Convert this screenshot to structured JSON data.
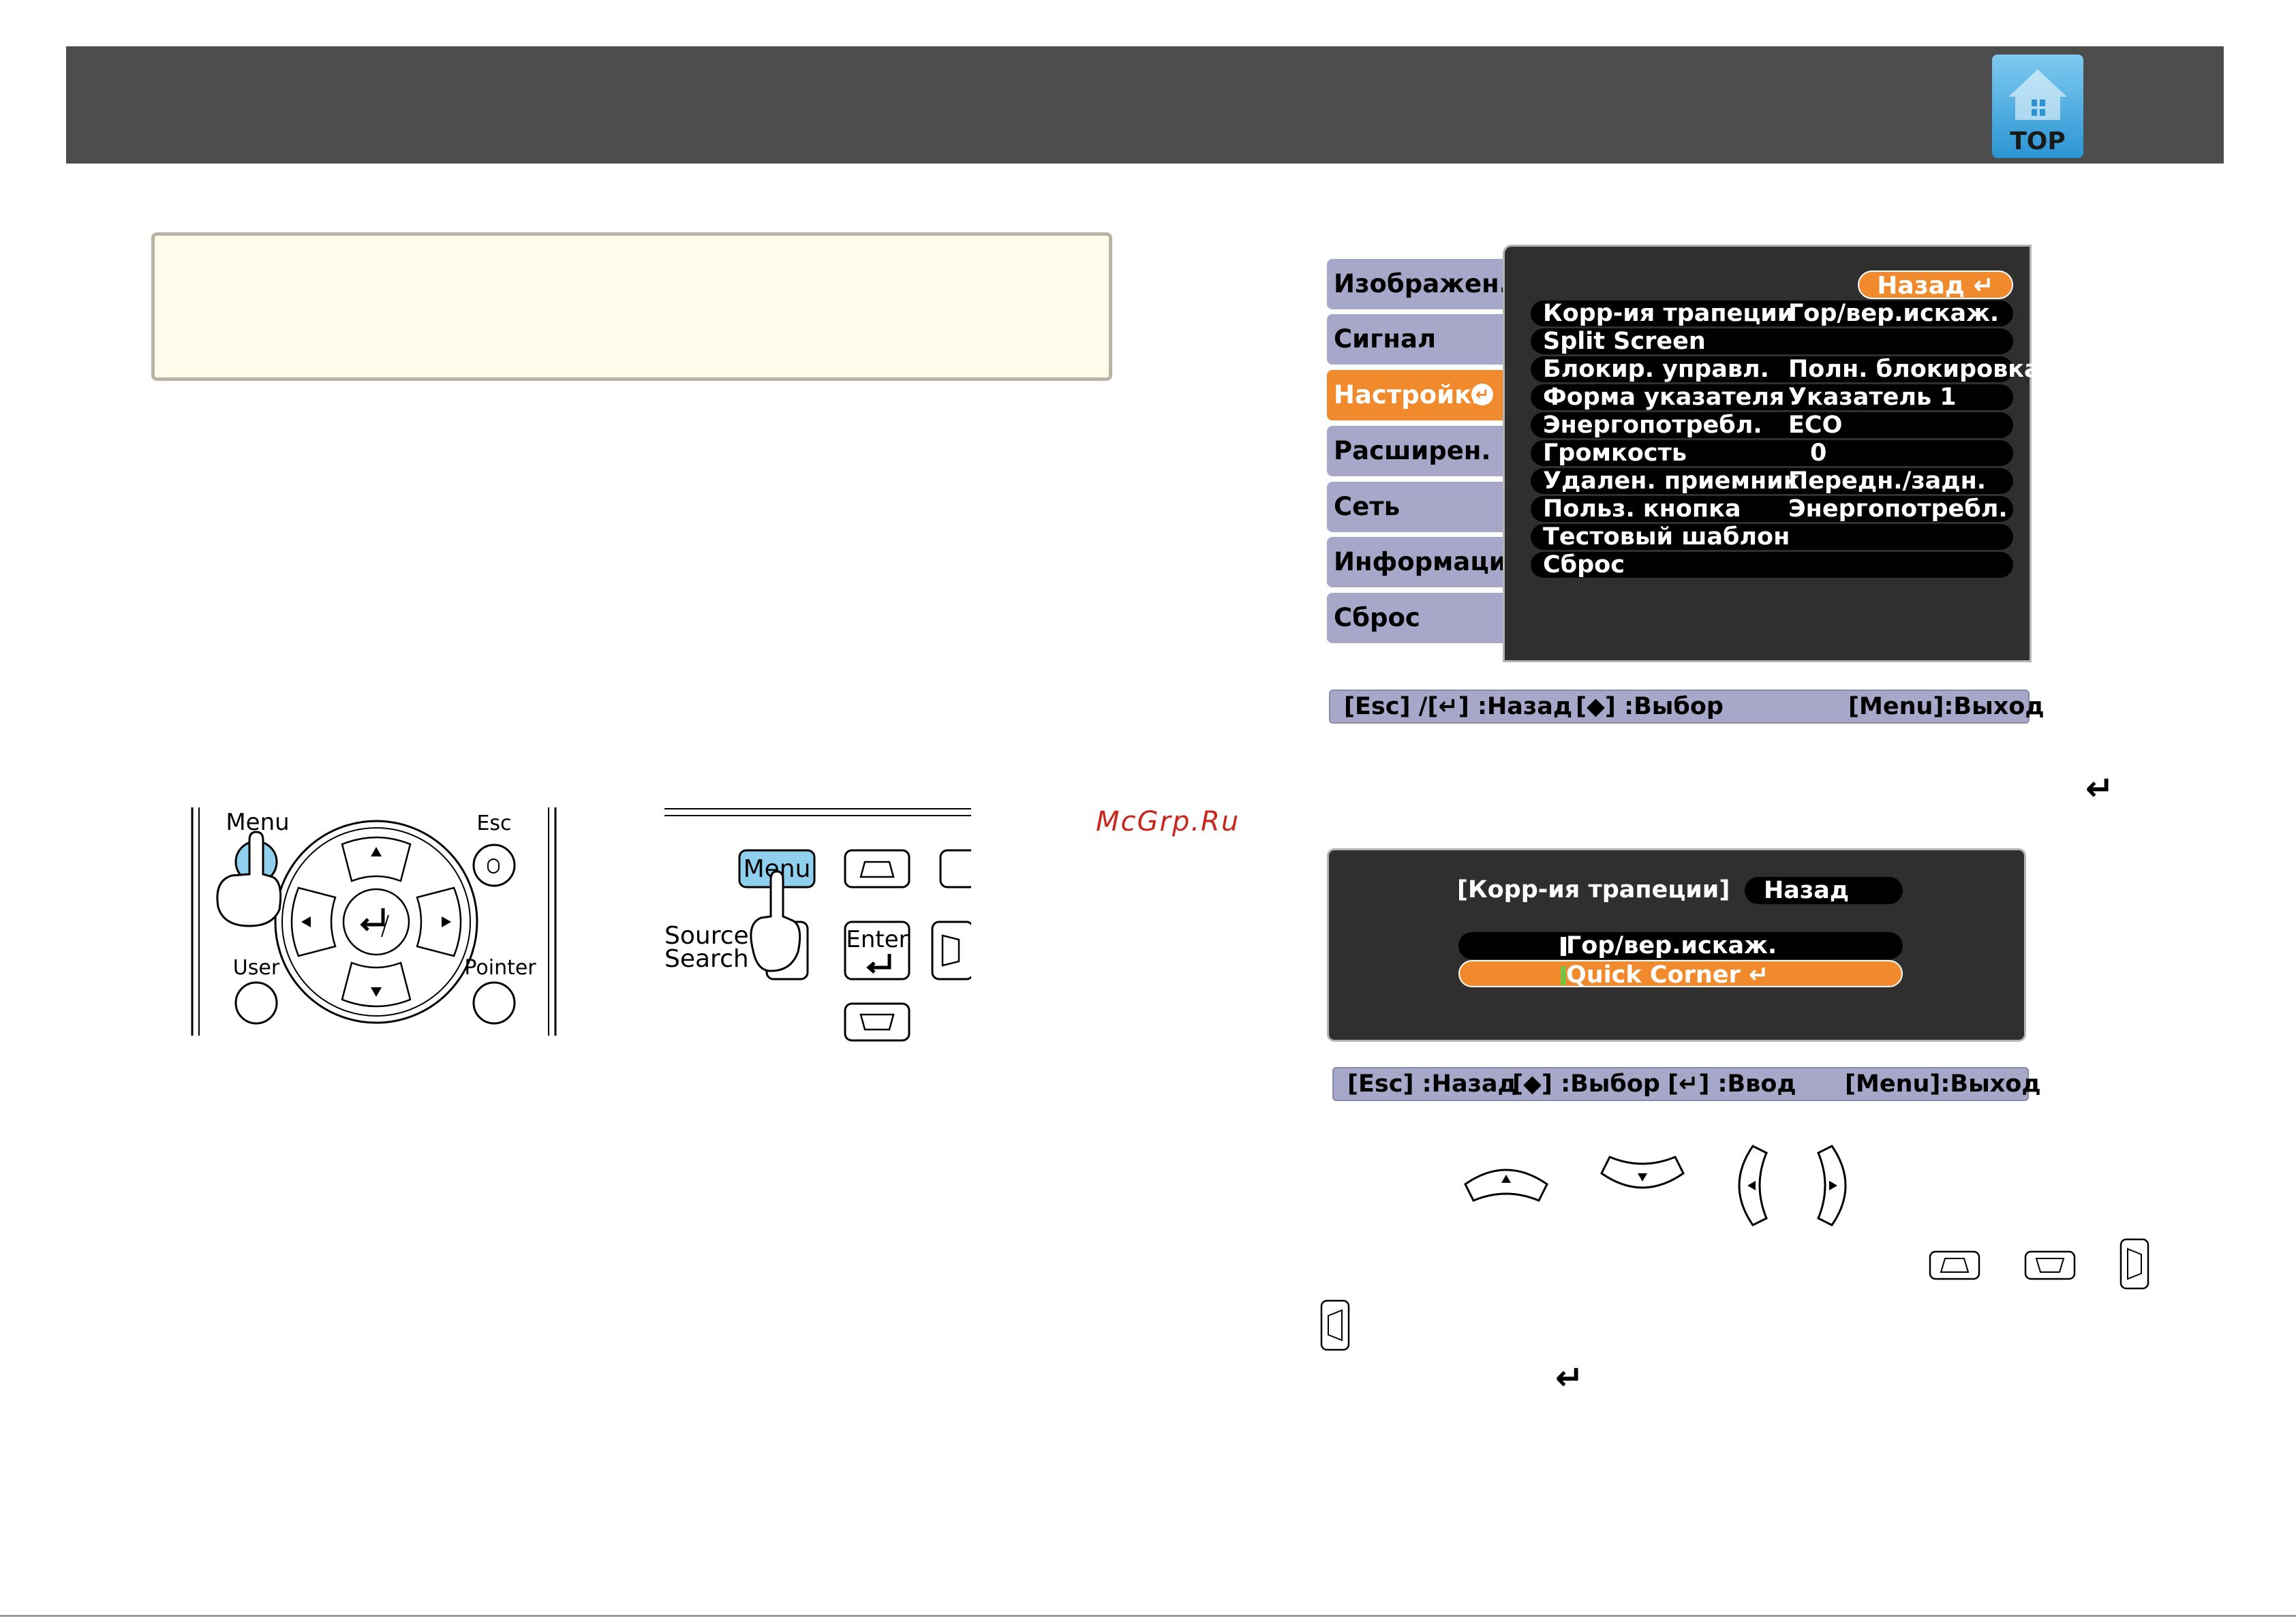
{
  "header": {
    "top_label": "TOP"
  },
  "remote": {
    "menu_label": "Menu",
    "esc_label": "Esc",
    "user_label": "User",
    "pointer_label": "Pointer"
  },
  "control_panel": {
    "menu_label": "Menu",
    "source_search_line1": "Source",
    "source_search_line2": "Search",
    "enter_label": "Enter"
  },
  "watermark": "McGrp.Ru",
  "config_menu": {
    "tabs": [
      {
        "label": "Изображен."
      },
      {
        "label": "Сигнал"
      },
      {
        "label": "Настройки"
      },
      {
        "label": "Расширен."
      },
      {
        "label": "Сеть"
      },
      {
        "label": "Информация"
      },
      {
        "label": "Сброс"
      }
    ],
    "back_label": "Назад",
    "items": [
      {
        "name": "Корр-ия трапеции",
        "value": "Гор/вер.искаж."
      },
      {
        "name": "Split Screen",
        "value": ""
      },
      {
        "name": "Блокир. управл.",
        "value": "Полн. блокировка"
      },
      {
        "name": "Форма указателя",
        "value": "Указатель 1"
      },
      {
        "name": "Энергопотребл.",
        "value": "ECO"
      },
      {
        "name": "Громкость",
        "value": "0"
      },
      {
        "name": "Удален. приемник",
        "value": "Передн./задн."
      },
      {
        "name": "Польз. кнопка",
        "value": "Энергопотребл."
      },
      {
        "name": "Тестовый шаблон",
        "value": ""
      },
      {
        "name": "Сброс",
        "value": ""
      }
    ],
    "help_bar": {
      "back": "[Esc] /[↵] :Назад",
      "select": "[◆] :Выбор",
      "exit": "[Menu]:Выход"
    }
  },
  "keystone_menu": {
    "title": "[Корр-ия трапеции]",
    "back_label": "Назад",
    "options": [
      {
        "label": "Гор/вер.искаж."
      },
      {
        "label": "Quick Corner"
      }
    ],
    "help_bar": {
      "back": "[Esc] :Назад",
      "select": "[◆] :Выбор",
      "enter": "[↵] :Ввод",
      "exit": "[Menu]:Выход"
    }
  },
  "colors": {
    "header": "#4d4d4d",
    "accent_orange": "#f08a2c",
    "tab_lavender": "#a7a7c9",
    "panel_dark": "#2f2f2f",
    "note_bg": "#fdfbe9",
    "button_highlight": "#8fd0ee"
  }
}
